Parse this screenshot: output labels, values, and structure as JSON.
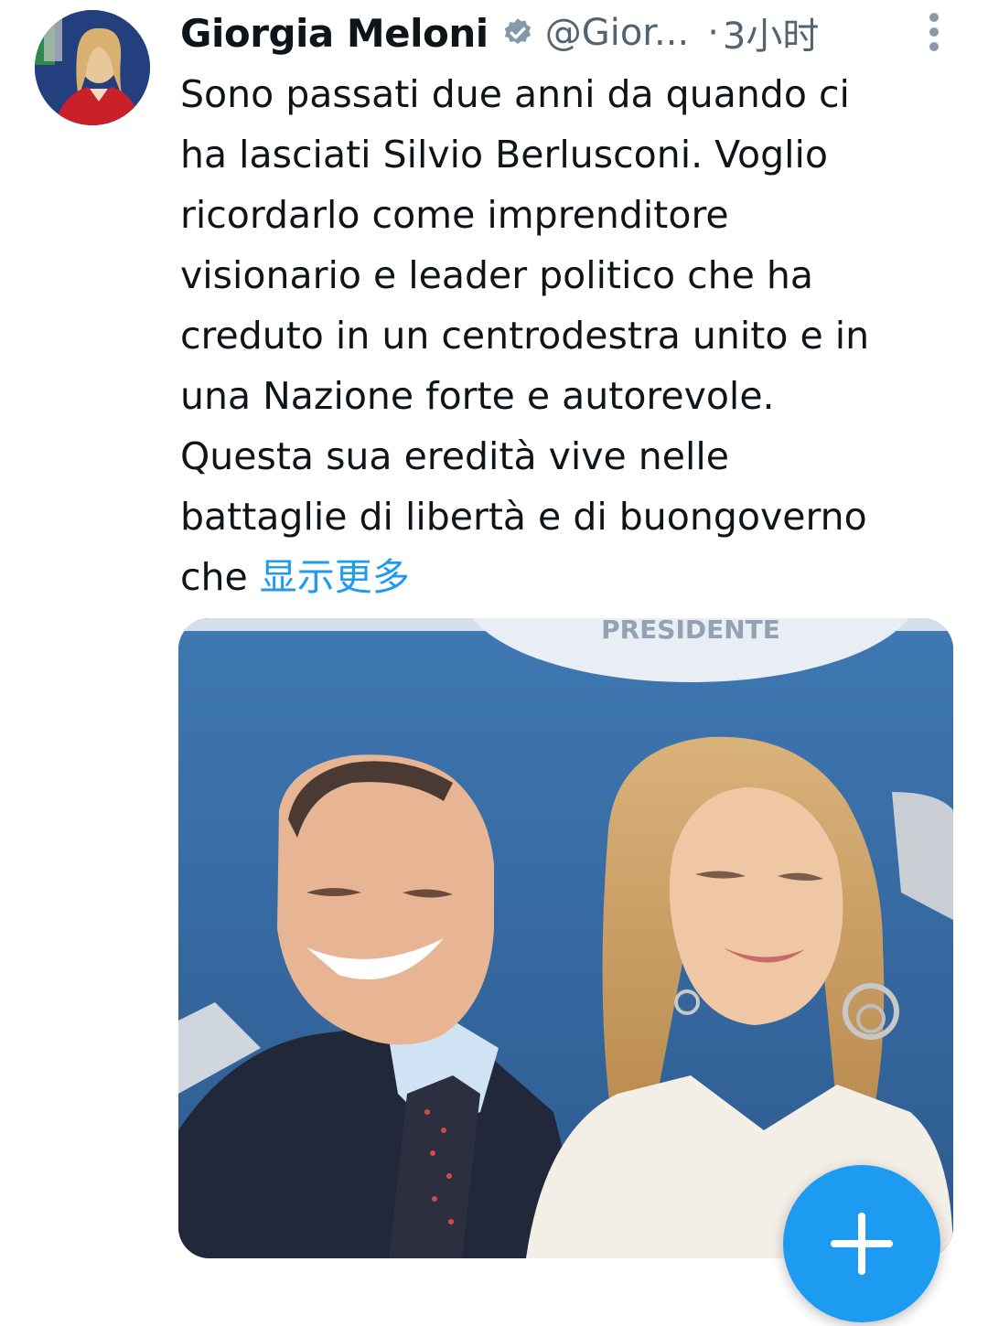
{
  "tweet": {
    "author_name": "Giorgia Meloni",
    "verified": true,
    "handle": "@Gior...",
    "separator": "·",
    "time": "3小时",
    "text": "Sono passati due anni da quando ci\nha lasciati Silvio Berlusconi. Voglio\nricordarlo come imprenditore\nvisionario e leader politico che ha\ncreduto in un centrodestra unito e in\nuna Nazione forte e autorevole.\nQuesta sua eredità vive nelle\nbattaglie di libertà e di buongoverno\nche ",
    "show_more": "显示更多",
    "media_backdrop_text": "PRESIDENTE"
  },
  "colors": {
    "accent": "#1d9bf0",
    "secondary_text": "#536471",
    "primary_text": "#0f1419",
    "verified_badge": "#829aab"
  },
  "icons": {
    "verified": "verified-badge-icon",
    "more": "more-vertical-icon",
    "compose": "compose-plus-icon"
  }
}
